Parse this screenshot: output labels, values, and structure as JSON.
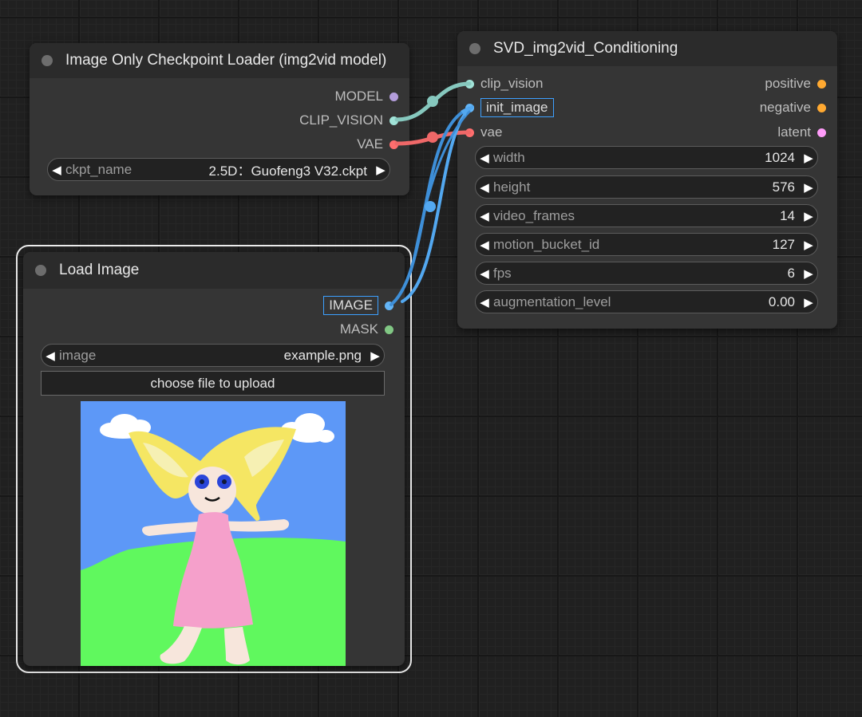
{
  "colors": {
    "canvas_bg": "#202020",
    "node_bg": "#353535",
    "title_bg": "#2b2b2b",
    "model_slot": "#b39ddb",
    "clip_vision_slot": "#a1e3d8",
    "vae_slot": "#ff6e6e",
    "image_slot": "#64b5f6",
    "mask_slot": "#81c784",
    "conditioning_slot": "#ffa931",
    "latent_slot": "#ff9cf9",
    "selection_outline": "#3da0ff"
  },
  "nodes": {
    "checkpoint_loader": {
      "title": "Image Only Checkpoint Loader (img2vid model)",
      "outputs": [
        {
          "label": "MODEL",
          "color": "#b39ddb"
        },
        {
          "label": "CLIP_VISION",
          "color": "#a1e3d8"
        },
        {
          "label": "VAE",
          "color": "#ff6e6e"
        }
      ],
      "ckpt_widget": {
        "label": "ckpt_name",
        "value": "2.5D：Guofeng3 V32.ckpt"
      }
    },
    "load_image": {
      "title": "Load Image",
      "outputs": [
        {
          "label": "IMAGE",
          "color": "#64b5f6"
        },
        {
          "label": "MASK",
          "color": "#81c784"
        }
      ],
      "image_widget": {
        "label": "image",
        "value": "example.png"
      },
      "upload_label": "choose file to upload"
    },
    "svd_conditioning": {
      "title": "SVD_img2vid_Conditioning",
      "inputs": [
        {
          "label": "clip_vision",
          "color": "#a1e3d8"
        },
        {
          "label": "init_image",
          "color": "#64b5f6"
        },
        {
          "label": "vae",
          "color": "#ff6e6e"
        }
      ],
      "outputs": [
        {
          "label": "positive",
          "color": "#ffa931"
        },
        {
          "label": "negative",
          "color": "#ffa931"
        },
        {
          "label": "latent",
          "color": "#ff9cf9"
        }
      ],
      "widgets": [
        {
          "label": "width",
          "value": "1024"
        },
        {
          "label": "height",
          "value": "576"
        },
        {
          "label": "video_frames",
          "value": "14"
        },
        {
          "label": "motion_bucket_id",
          "value": "127"
        },
        {
          "label": "fps",
          "value": "6"
        },
        {
          "label": "augmentation_level",
          "value": "0.00"
        }
      ]
    }
  }
}
